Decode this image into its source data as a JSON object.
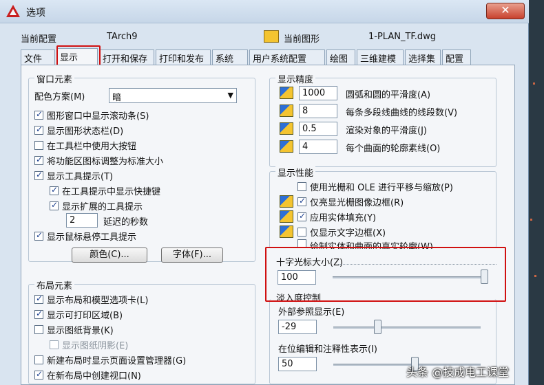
{
  "window": {
    "title": "选项",
    "close_label": "✕"
  },
  "current_profile": {
    "label": "当前配置",
    "value": "TArch9"
  },
  "current_drawing": {
    "label": "当前图形",
    "value": "1-PLAN_TF.dwg"
  },
  "tabs": [
    {
      "label": "文件"
    },
    {
      "label": "显示",
      "active": true
    },
    {
      "label": "打开和保存"
    },
    {
      "label": "打印和发布"
    },
    {
      "label": "系统"
    },
    {
      "label": "用户系统配置"
    },
    {
      "label": "绘图"
    },
    {
      "label": "三维建模"
    },
    {
      "label": "选择集"
    },
    {
      "label": "配置"
    }
  ],
  "window_elements": {
    "title": "窗口元素",
    "color_scheme_label": "配色方案(M)",
    "color_scheme_value": "暗",
    "checkboxes": [
      {
        "label": "图形窗口中显示滚动条(S)",
        "checked": true
      },
      {
        "label": "显示图形状态栏(D)",
        "checked": true
      },
      {
        "label": "在工具栏中使用大按钮",
        "checked": false
      },
      {
        "label": "将功能区图标调整为标准大小",
        "checked": true
      },
      {
        "label": "显示工具提示(T)",
        "checked": true
      },
      {
        "label": "在工具提示中显示快捷键",
        "checked": true
      },
      {
        "label": "显示扩展的工具提示",
        "checked": true
      },
      {
        "label": "显示鼠标悬停工具提示",
        "checked": true
      }
    ],
    "delay_value": "2",
    "delay_label": "延迟的秒数",
    "colors_button": "颜色(C)...",
    "fonts_button": "字体(F)..."
  },
  "layout_elements": {
    "title": "布局元素",
    "checkboxes": [
      {
        "label": "显示布局和模型选项卡(L)",
        "checked": true
      },
      {
        "label": "显示可打印区域(B)",
        "checked": true
      },
      {
        "label": "显示图纸背景(K)",
        "checked": false
      },
      {
        "label": "显示图纸阴影(E)",
        "checked": false,
        "disabled": true
      },
      {
        "label": "新建布局时显示页面设置管理器(G)",
        "checked": false
      },
      {
        "label": "在新布局中创建视口(N)",
        "checked": true
      }
    ]
  },
  "display_resolution": {
    "title": "显示精度",
    "items": [
      {
        "value": "1000",
        "label": "圆弧和圆的平滑度(A)"
      },
      {
        "value": "8",
        "label": "每条多段线曲线的线段数(V)"
      },
      {
        "value": "0.5",
        "label": "渲染对象的平滑度(J)"
      },
      {
        "value": "4",
        "label": "每个曲面的轮廓素线(O)"
      }
    ]
  },
  "display_performance": {
    "title": "显示性能",
    "checkboxes": [
      {
        "label": "使用光栅和 OLE 进行平移与缩放(P)",
        "checked": false
      },
      {
        "label": "仅亮显光栅图像边框(R)",
        "checked": true
      },
      {
        "label": "应用实体填充(Y)",
        "checked": true
      },
      {
        "label": "仅显示文字边框(X)",
        "checked": false
      },
      {
        "label": "绘制实体和曲面的真实轮廓(W)",
        "checked": false
      }
    ]
  },
  "crosshair": {
    "label": "十字光标大小(Z)",
    "value": "100",
    "fraction": 1.0
  },
  "fade_control": {
    "label": "淡入度控制",
    "xref_label": "外部参照显示(E)",
    "xref_value": "-29",
    "xref_fraction": 0.3,
    "inplace_label": "在位编辑和注释性表示(I)",
    "inplace_value": "50",
    "inplace_fraction": 0.55
  },
  "watermark": "头条 @技成电工课堂",
  "colors": {
    "highlight_box": "#d01010",
    "window_bg": "#d9e4f0",
    "panel_bg": "#f4f6f9"
  }
}
